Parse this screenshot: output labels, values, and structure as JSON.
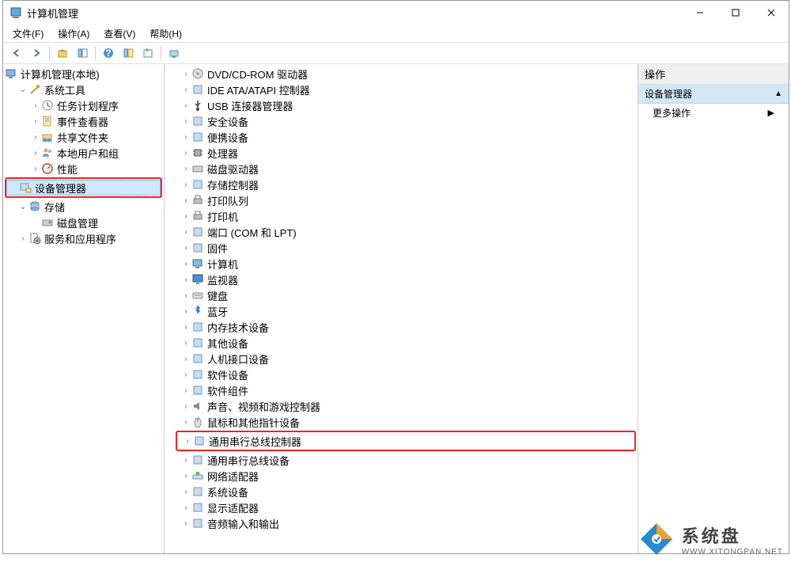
{
  "window": {
    "title": "计算机管理"
  },
  "menu": {
    "file": "文件(F)",
    "action": "操作(A)",
    "view": "查看(V)",
    "help": "帮助(H)"
  },
  "left_tree": {
    "root": "计算机管理(本地)",
    "system_tools": "系统工具",
    "task_scheduler": "任务计划程序",
    "event_viewer": "事件查看器",
    "shared_folders": "共享文件夹",
    "local_users": "本地用户和组",
    "performance": "性能",
    "device_manager": "设备管理器",
    "storage": "存储",
    "disk_mgmt": "磁盘管理",
    "services_apps": "服务和应用程序"
  },
  "devices": [
    {
      "label": "DVD/CD-ROM 驱动器",
      "icon": "dvd"
    },
    {
      "label": "IDE ATA/ATAPI 控制器",
      "icon": "ide"
    },
    {
      "label": "USB 连接器管理器",
      "icon": "usb"
    },
    {
      "label": "安全设备",
      "icon": "security"
    },
    {
      "label": "便携设备",
      "icon": "portable"
    },
    {
      "label": "处理器",
      "icon": "cpu"
    },
    {
      "label": "磁盘驱动器",
      "icon": "disk"
    },
    {
      "label": "存储控制器",
      "icon": "storage"
    },
    {
      "label": "打印队列",
      "icon": "printer"
    },
    {
      "label": "打印机",
      "icon": "printer"
    },
    {
      "label": "端口 (COM 和 LPT)",
      "icon": "port"
    },
    {
      "label": "固件",
      "icon": "firmware"
    },
    {
      "label": "计算机",
      "icon": "computer"
    },
    {
      "label": "监视器",
      "icon": "monitor"
    },
    {
      "label": "键盘",
      "icon": "keyboard"
    },
    {
      "label": "蓝牙",
      "icon": "bluetooth"
    },
    {
      "label": "内存技术设备",
      "icon": "memory"
    },
    {
      "label": "其他设备",
      "icon": "other"
    },
    {
      "label": "人机接口设备",
      "icon": "hid"
    },
    {
      "label": "软件设备",
      "icon": "software"
    },
    {
      "label": "软件组件",
      "icon": "software"
    },
    {
      "label": "声音、视频和游戏控制器",
      "icon": "sound"
    },
    {
      "label": "鼠标和其他指针设备",
      "icon": "mouse",
      "half_highlight_top": true
    },
    {
      "label": "通用串行总线控制器",
      "icon": "usb-ctrl",
      "highlighted": true
    },
    {
      "label": "通用串行总线设备",
      "icon": "usb-dev"
    },
    {
      "label": "网络适配器",
      "icon": "network"
    },
    {
      "label": "系统设备",
      "icon": "system"
    },
    {
      "label": "显示适配器",
      "icon": "display"
    },
    {
      "label": "音频输入和输出",
      "icon": "audio"
    }
  ],
  "right": {
    "header": "操作",
    "section": "设备管理器",
    "more_actions": "更多操作"
  },
  "watermark": {
    "cn": "系统盘",
    "en": "WWW.XITONGPAN.NET"
  }
}
